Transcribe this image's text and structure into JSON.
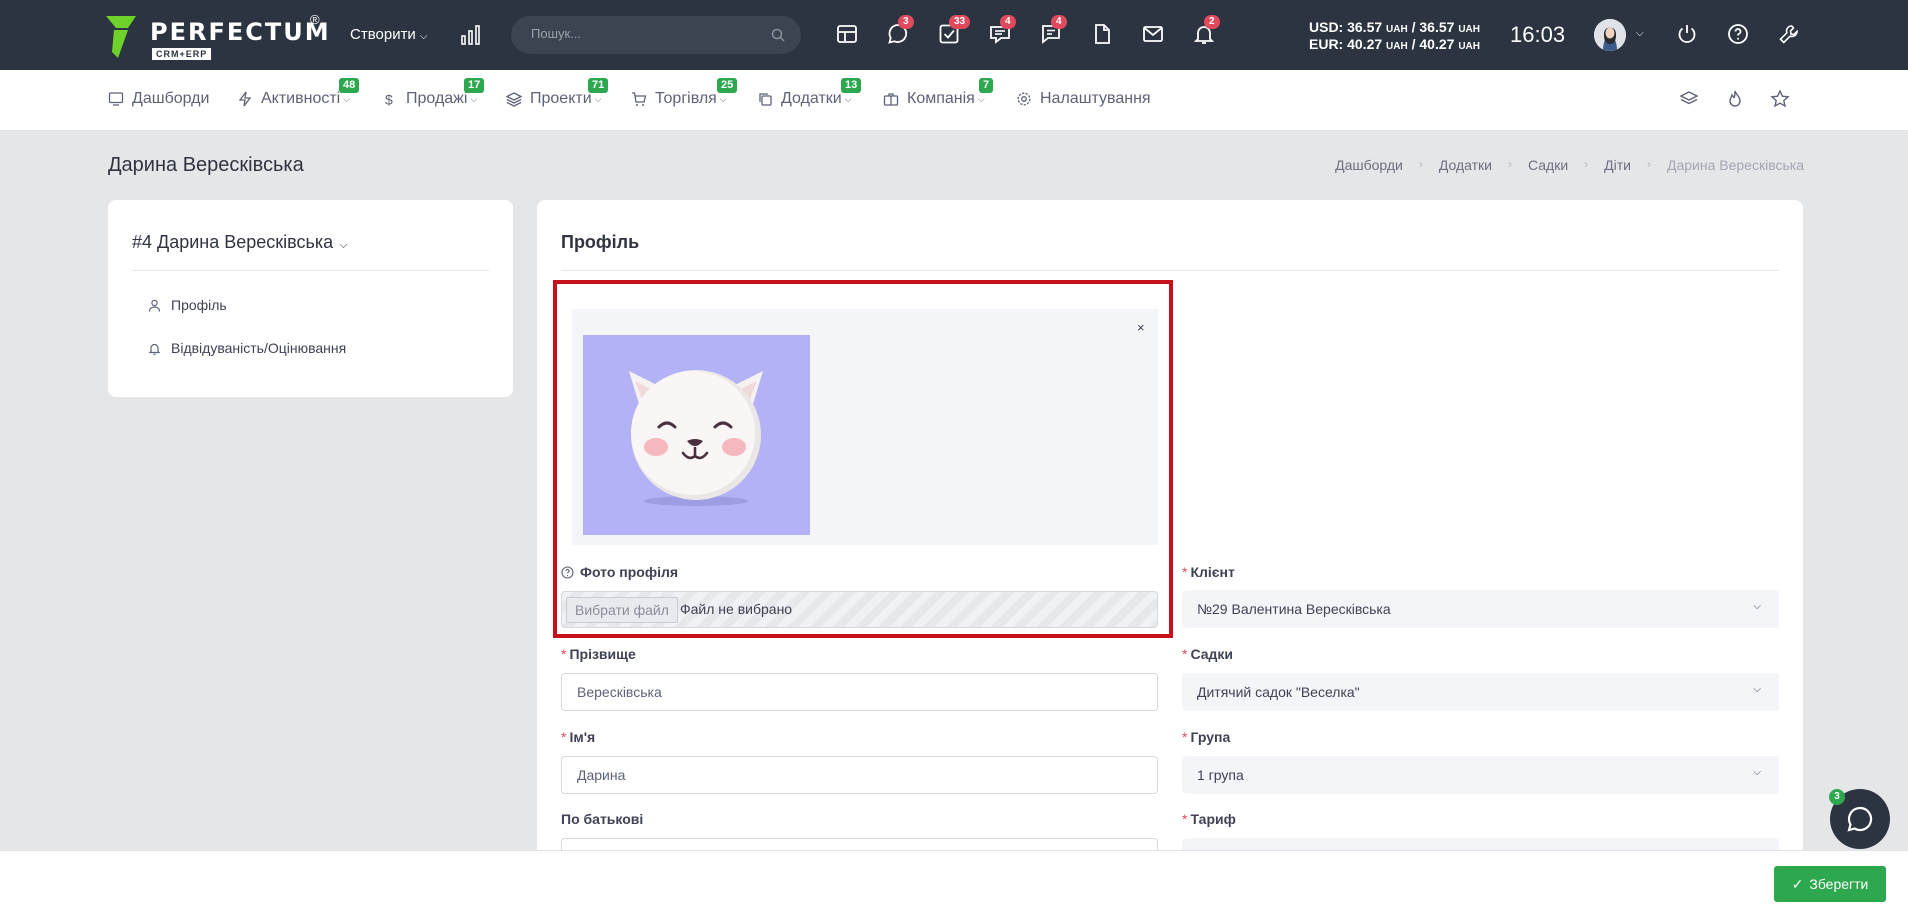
{
  "header": {
    "logo_text": "PERFECTUM",
    "logo_sub": "CRM+ERP",
    "logo_reg": "®",
    "create_label": "Створити",
    "search_placeholder": "Пошук...",
    "icons": [
      {
        "name": "calendar-icon",
        "badge": ""
      },
      {
        "name": "chat-icon",
        "badge": "3"
      },
      {
        "name": "tasks-icon",
        "badge": "33"
      },
      {
        "name": "messages-icon",
        "badge": "4"
      },
      {
        "name": "comments-icon",
        "badge": "4"
      },
      {
        "name": "document-icon",
        "badge": ""
      },
      {
        "name": "mail-icon",
        "badge": ""
      },
      {
        "name": "bell-icon",
        "badge": "2"
      }
    ],
    "rates": {
      "usd_prefix": "USD: 36.57",
      "usd_mid": "/ 36.57",
      "eur_prefix": "EUR: 40.27",
      "eur_mid": "/ 40.27",
      "unit": "UAH"
    },
    "time": "16:03"
  },
  "nav": {
    "items": [
      {
        "label": "Дашборди",
        "badge": "",
        "icon": "dashboard-icon"
      },
      {
        "label": "Активності",
        "badge": "48",
        "icon": "lightning-icon"
      },
      {
        "label": "Продажі",
        "badge": "17",
        "icon": "dollar-icon"
      },
      {
        "label": "Проекти",
        "badge": "71",
        "icon": "layers-icon"
      },
      {
        "label": "Торгівля",
        "badge": "25",
        "icon": "cart-icon"
      },
      {
        "label": "Додатки",
        "badge": "13",
        "icon": "copy-icon"
      },
      {
        "label": "Компанія",
        "badge": "7",
        "icon": "briefcase-icon"
      },
      {
        "label": "Налаштування",
        "badge": "",
        "icon": "gear-icon"
      }
    ]
  },
  "page": {
    "title": "Дарина Вересківська",
    "breadcrumb": [
      "Дашборди",
      "Додатки",
      "Садки",
      "Діти",
      "Дарина Вересківська"
    ]
  },
  "left_card": {
    "title": "#4 Дарина Вересківська",
    "items": [
      {
        "label": "Профіль",
        "icon": "user-icon"
      },
      {
        "label": "Відвідуваність/Оцінювання",
        "icon": "bell-icon"
      }
    ]
  },
  "profile": {
    "title": "Профіль",
    "close_symbol": "×",
    "photo_label": "Фото профіля",
    "file_button": "Вибрати файл",
    "file_status": "Файл не вибрано",
    "surname_label": "Прізвище",
    "surname_value": "Вересківська",
    "name_label": "Ім'я",
    "name_value": "Дарина",
    "patronymic_label": "По батькові",
    "client_label": "Клієнт",
    "client_value": "№29 Валентина Вересківська",
    "kindergarten_label": "Садки",
    "kindergarten_value": "Дитячий садок \"Веселка\"",
    "group_label": "Група",
    "group_value": "1 група",
    "tariff_label": "Тариф",
    "required_mark": "*"
  },
  "footer": {
    "save_label": "Зберегти",
    "chat_badge": "3"
  },
  "colors": {
    "topbar": "#2b3440",
    "badge_red": "#e04a5c",
    "badge_green": "#2ea84f",
    "highlight": "#c8101c",
    "photo_bg": "#b3b2f6"
  }
}
